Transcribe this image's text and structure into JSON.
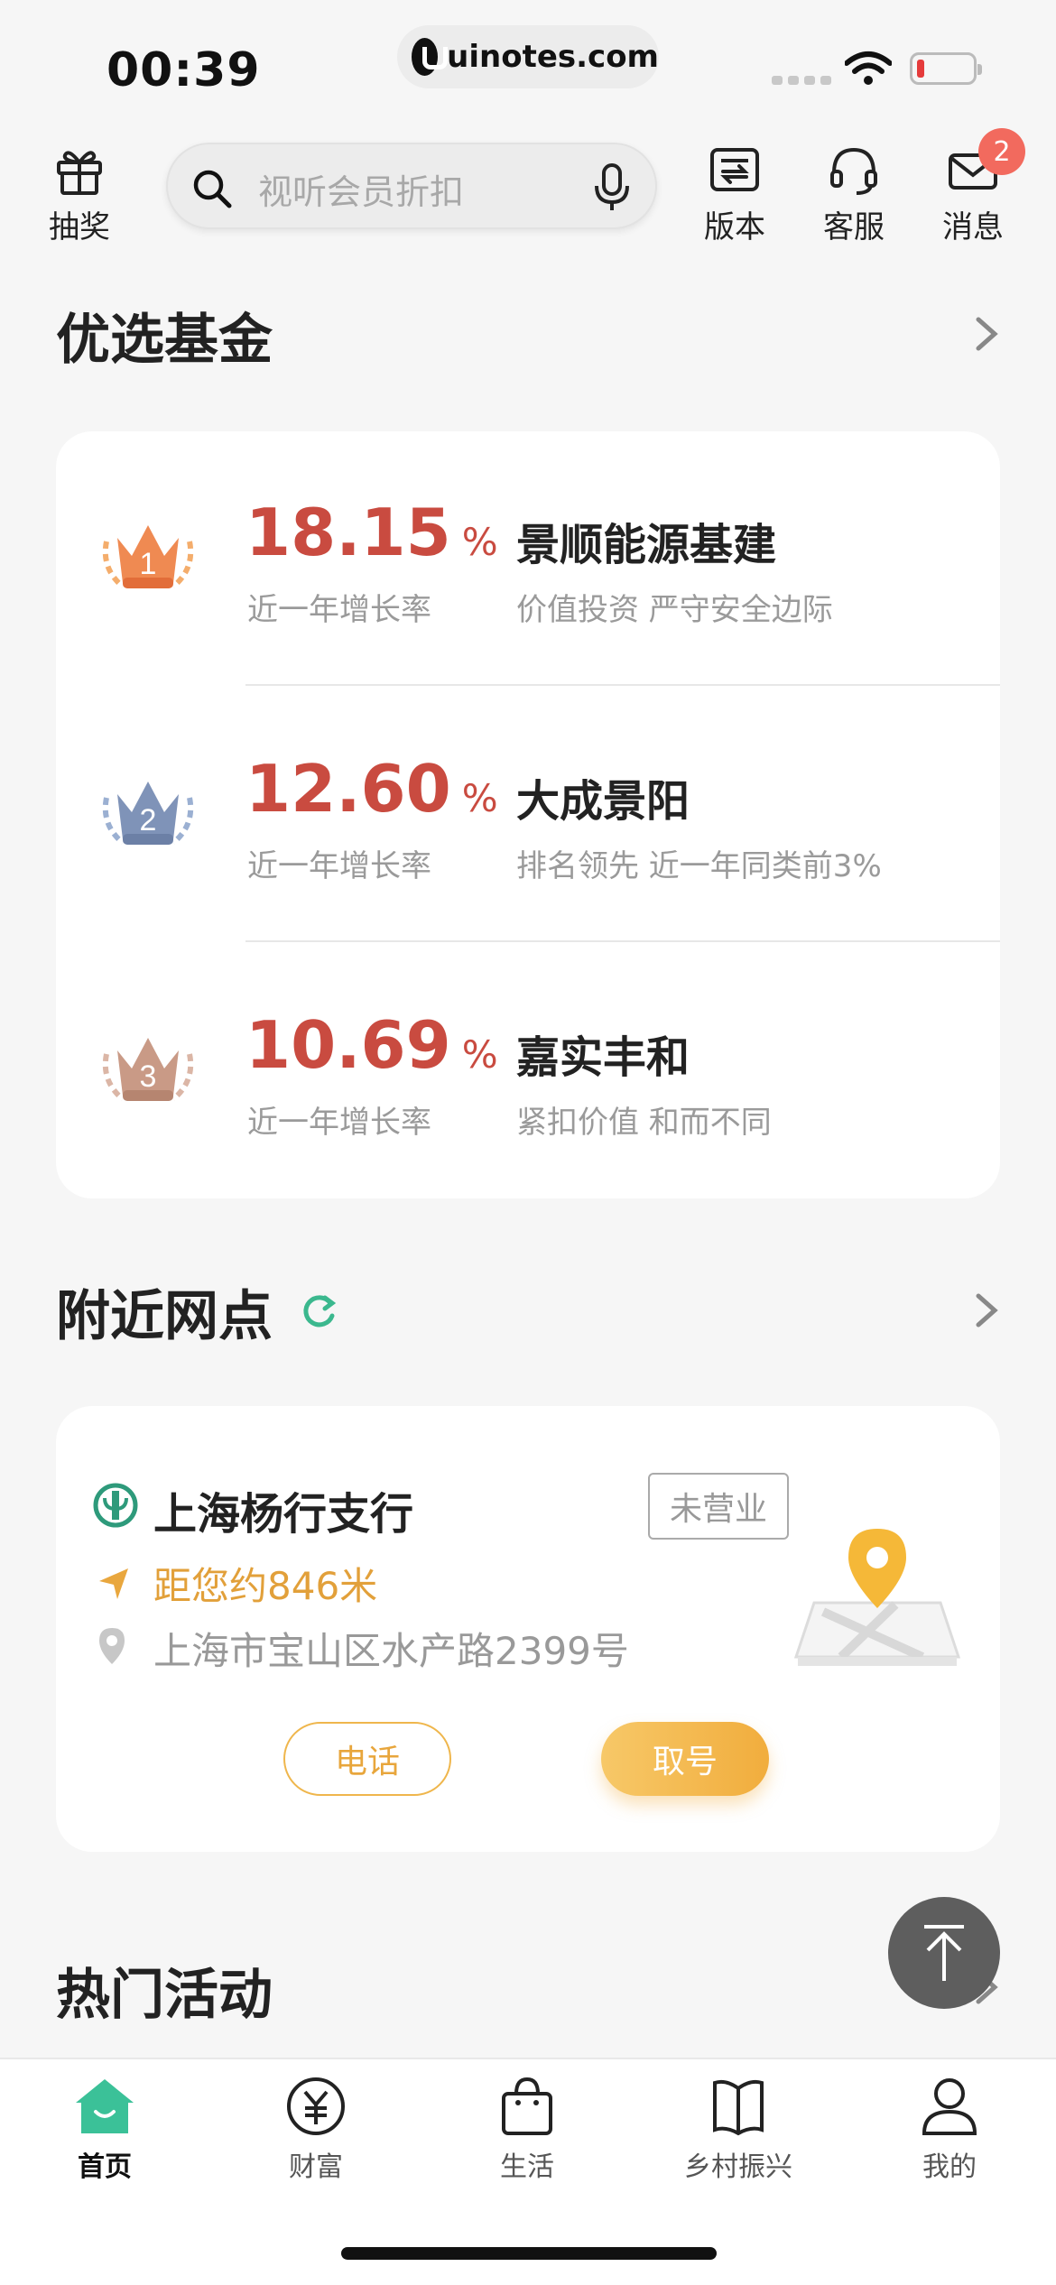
{
  "status_bar": {
    "time": "00:39",
    "url": "uinotes.com"
  },
  "header": {
    "lottery_label": "抽奖",
    "search_placeholder": "视听会员折扣",
    "version_label": "版本",
    "service_label": "客服",
    "message_label": "消息",
    "message_badge": "2"
  },
  "funds": {
    "title": "优选基金",
    "items": [
      {
        "rank": "1",
        "rate": "18.15",
        "pct": "%",
        "rate_label": "近一年增长率",
        "name": "景顺能源基建",
        "desc": "价值投资 严守安全边际",
        "medal_color": "#ef8a52"
      },
      {
        "rank": "2",
        "rate": "12.60",
        "pct": "%",
        "rate_label": "近一年增长率",
        "name": "大成景阳",
        "desc": "排名领先 近一年同类前3%",
        "medal_color": "#7f93b8"
      },
      {
        "rank": "3",
        "rate": "10.69",
        "pct": "%",
        "rate_label": "近一年增长率",
        "name": "嘉实丰和",
        "desc": "紧扣价值 和而不同",
        "medal_color": "#c99a86"
      }
    ]
  },
  "branch": {
    "title": "附近网点",
    "name": "上海杨行支行",
    "status": "未营业",
    "distance": "距您约846米",
    "address": "上海市宝山区水产路2399号",
    "call_label": "电话",
    "ticket_label": "取号"
  },
  "activities": {
    "title": "热门活动"
  },
  "bottom_nav": [
    {
      "label": "首页",
      "icon": "home-icon",
      "active": true
    },
    {
      "label": "财富",
      "icon": "yuan-icon",
      "active": false
    },
    {
      "label": "生活",
      "icon": "shopping-bag-icon",
      "active": false
    },
    {
      "label": "乡村振兴",
      "icon": "book-icon",
      "active": false
    },
    {
      "label": "我的",
      "icon": "user-icon",
      "active": false
    }
  ],
  "colors": {
    "accent_red": "#c94b40",
    "accent_orange": "#f1ad3d",
    "brand_green": "#3bb88e"
  }
}
